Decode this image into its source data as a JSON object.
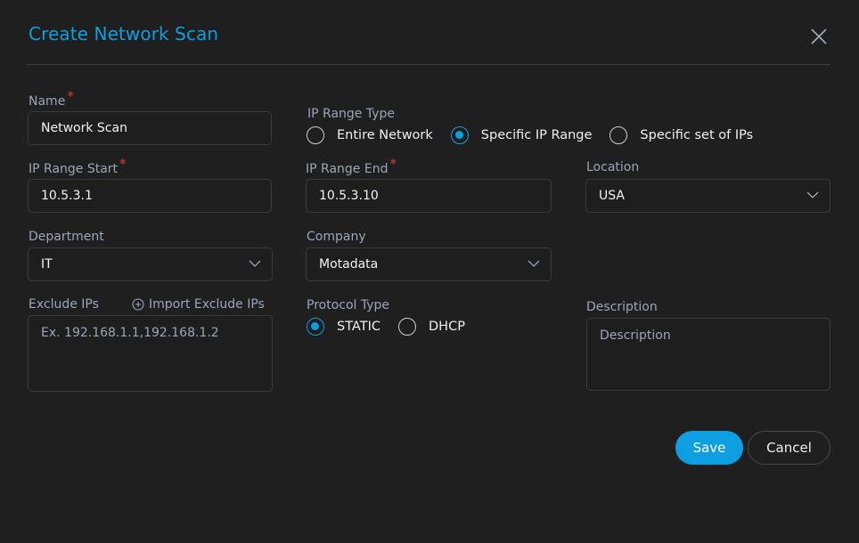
{
  "dialog": {
    "title": "Create Network Scan",
    "close_icon": "close-icon"
  },
  "form": {
    "name": {
      "label": "Name",
      "required_mark": "*",
      "value": "Network Scan"
    },
    "ip_range_type": {
      "label": "IP Range Type",
      "options": [
        {
          "label": "Entire Network",
          "checked": false
        },
        {
          "label": "Specific IP Range",
          "checked": true
        },
        {
          "label": "Specific set of IPs",
          "checked": false
        }
      ]
    },
    "ip_range_start": {
      "label": "IP Range Start",
      "required_mark": "*",
      "value": "10.5.3.1"
    },
    "ip_range_end": {
      "label": "IP Range End",
      "required_mark": "*",
      "value": "10.5.3.10"
    },
    "location": {
      "label": "Location",
      "value": "USA"
    },
    "department": {
      "label": "Department",
      "value": "IT"
    },
    "company": {
      "label": "Company",
      "value": "Motadata"
    },
    "exclude_ips": {
      "label": "Exclude IPs",
      "placeholder": "Ex. 192.168.1.1,192.168.1.2",
      "import_label": "Import Exclude IPs"
    },
    "protocol_type": {
      "label": "Protocol Type",
      "options": [
        {
          "label": "STATIC",
          "checked": true
        },
        {
          "label": "DHCP",
          "checked": false
        }
      ]
    },
    "description": {
      "label": "Description",
      "placeholder": "Description"
    }
  },
  "actions": {
    "save_label": "Save",
    "cancel_label": "Cancel"
  },
  "colors": {
    "accent": "#0e9fe0",
    "required": "#e53935",
    "background": "#1f1f1f",
    "label": "#9aa6b8"
  }
}
